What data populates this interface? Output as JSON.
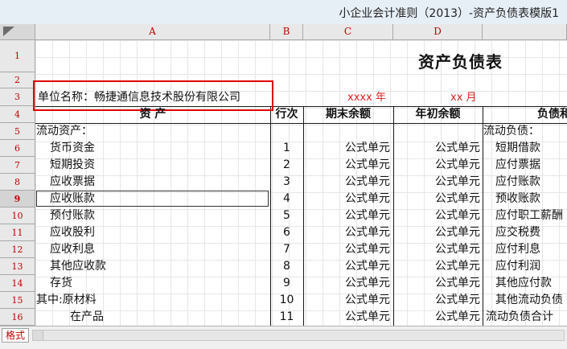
{
  "window": {
    "title": "小企业会计准则（2013）-资产负债表模版1"
  },
  "sheet": {
    "columns": [
      "A",
      "B",
      "C",
      "D"
    ],
    "rows": [
      "1",
      "2",
      "3",
      "4",
      "5",
      "6",
      "7",
      "8",
      "9",
      "10",
      "11",
      "12",
      "13",
      "14",
      "15",
      "16"
    ],
    "selected_row": "9",
    "report_title": "资产负债表",
    "unit_label": "单位名称：畅捷通信息技术股份有限公司",
    "year_label": "xxxx 年",
    "month_label": "xx 月",
    "headers": {
      "asset": "资 产",
      "line": "行次",
      "end_balance": "期末余额",
      "begin_balance": "年初余额",
      "liability": "负债和"
    },
    "section_current_assets": "流动资产：",
    "section_current_liabilities": "流动负债：",
    "formula_text": "公式单元",
    "asset_rows": [
      {
        "name": "货币资金",
        "line": "1"
      },
      {
        "name": "短期投资",
        "line": "2"
      },
      {
        "name": "应收票据",
        "line": "3"
      },
      {
        "name": "应收账款",
        "line": "4"
      },
      {
        "name": "预付账款",
        "line": "5"
      },
      {
        "name": "应收股利",
        "line": "6"
      },
      {
        "name": "应收利息",
        "line": "7"
      },
      {
        "name": "其他应收款",
        "line": "8"
      },
      {
        "name": "存货",
        "line": "9"
      },
      {
        "name": "其中:原材料",
        "line": "10"
      },
      {
        "name": "在产品",
        "line": "11"
      }
    ],
    "liability_rows": [
      "短期借款",
      "应付票据",
      "应付账款",
      "预收账款",
      "应付职工薪酬",
      "应交税费",
      "应付利息",
      "应付利润",
      "其他应付款",
      "其他流动负债",
      "流动负债合计"
    ]
  },
  "tabs": {
    "format_tab": "格式"
  }
}
